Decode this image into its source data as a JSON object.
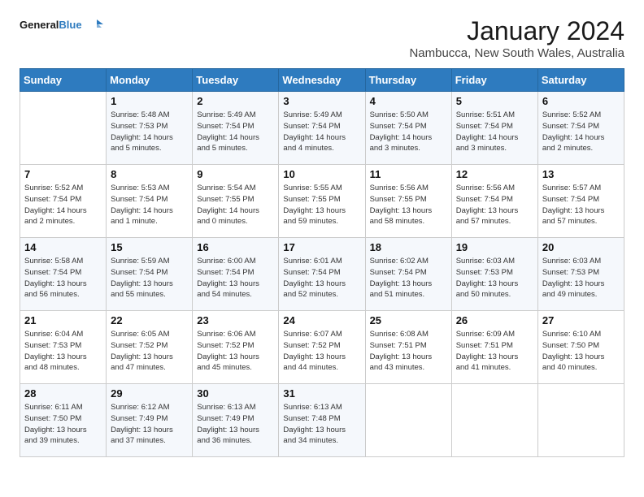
{
  "logo": {
    "line1": "General",
    "line2": "Blue"
  },
  "title": "January 2024",
  "location": "Nambucca, New South Wales, Australia",
  "days_of_week": [
    "Sunday",
    "Monday",
    "Tuesday",
    "Wednesday",
    "Thursday",
    "Friday",
    "Saturday"
  ],
  "weeks": [
    [
      {
        "num": "",
        "info": ""
      },
      {
        "num": "1",
        "info": "Sunrise: 5:48 AM\nSunset: 7:53 PM\nDaylight: 14 hours\nand 5 minutes."
      },
      {
        "num": "2",
        "info": "Sunrise: 5:49 AM\nSunset: 7:54 PM\nDaylight: 14 hours\nand 5 minutes."
      },
      {
        "num": "3",
        "info": "Sunrise: 5:49 AM\nSunset: 7:54 PM\nDaylight: 14 hours\nand 4 minutes."
      },
      {
        "num": "4",
        "info": "Sunrise: 5:50 AM\nSunset: 7:54 PM\nDaylight: 14 hours\nand 3 minutes."
      },
      {
        "num": "5",
        "info": "Sunrise: 5:51 AM\nSunset: 7:54 PM\nDaylight: 14 hours\nand 3 minutes."
      },
      {
        "num": "6",
        "info": "Sunrise: 5:52 AM\nSunset: 7:54 PM\nDaylight: 14 hours\nand 2 minutes."
      }
    ],
    [
      {
        "num": "7",
        "info": "Sunrise: 5:52 AM\nSunset: 7:54 PM\nDaylight: 14 hours\nand 2 minutes."
      },
      {
        "num": "8",
        "info": "Sunrise: 5:53 AM\nSunset: 7:54 PM\nDaylight: 14 hours\nand 1 minute."
      },
      {
        "num": "9",
        "info": "Sunrise: 5:54 AM\nSunset: 7:55 PM\nDaylight: 14 hours\nand 0 minutes."
      },
      {
        "num": "10",
        "info": "Sunrise: 5:55 AM\nSunset: 7:55 PM\nDaylight: 13 hours\nand 59 minutes."
      },
      {
        "num": "11",
        "info": "Sunrise: 5:56 AM\nSunset: 7:55 PM\nDaylight: 13 hours\nand 58 minutes."
      },
      {
        "num": "12",
        "info": "Sunrise: 5:56 AM\nSunset: 7:54 PM\nDaylight: 13 hours\nand 57 minutes."
      },
      {
        "num": "13",
        "info": "Sunrise: 5:57 AM\nSunset: 7:54 PM\nDaylight: 13 hours\nand 57 minutes."
      }
    ],
    [
      {
        "num": "14",
        "info": "Sunrise: 5:58 AM\nSunset: 7:54 PM\nDaylight: 13 hours\nand 56 minutes."
      },
      {
        "num": "15",
        "info": "Sunrise: 5:59 AM\nSunset: 7:54 PM\nDaylight: 13 hours\nand 55 minutes."
      },
      {
        "num": "16",
        "info": "Sunrise: 6:00 AM\nSunset: 7:54 PM\nDaylight: 13 hours\nand 54 minutes."
      },
      {
        "num": "17",
        "info": "Sunrise: 6:01 AM\nSunset: 7:54 PM\nDaylight: 13 hours\nand 52 minutes."
      },
      {
        "num": "18",
        "info": "Sunrise: 6:02 AM\nSunset: 7:54 PM\nDaylight: 13 hours\nand 51 minutes."
      },
      {
        "num": "19",
        "info": "Sunrise: 6:03 AM\nSunset: 7:53 PM\nDaylight: 13 hours\nand 50 minutes."
      },
      {
        "num": "20",
        "info": "Sunrise: 6:03 AM\nSunset: 7:53 PM\nDaylight: 13 hours\nand 49 minutes."
      }
    ],
    [
      {
        "num": "21",
        "info": "Sunrise: 6:04 AM\nSunset: 7:53 PM\nDaylight: 13 hours\nand 48 minutes."
      },
      {
        "num": "22",
        "info": "Sunrise: 6:05 AM\nSunset: 7:52 PM\nDaylight: 13 hours\nand 47 minutes."
      },
      {
        "num": "23",
        "info": "Sunrise: 6:06 AM\nSunset: 7:52 PM\nDaylight: 13 hours\nand 45 minutes."
      },
      {
        "num": "24",
        "info": "Sunrise: 6:07 AM\nSunset: 7:52 PM\nDaylight: 13 hours\nand 44 minutes."
      },
      {
        "num": "25",
        "info": "Sunrise: 6:08 AM\nSunset: 7:51 PM\nDaylight: 13 hours\nand 43 minutes."
      },
      {
        "num": "26",
        "info": "Sunrise: 6:09 AM\nSunset: 7:51 PM\nDaylight: 13 hours\nand 41 minutes."
      },
      {
        "num": "27",
        "info": "Sunrise: 6:10 AM\nSunset: 7:50 PM\nDaylight: 13 hours\nand 40 minutes."
      }
    ],
    [
      {
        "num": "28",
        "info": "Sunrise: 6:11 AM\nSunset: 7:50 PM\nDaylight: 13 hours\nand 39 minutes."
      },
      {
        "num": "29",
        "info": "Sunrise: 6:12 AM\nSunset: 7:49 PM\nDaylight: 13 hours\nand 37 minutes."
      },
      {
        "num": "30",
        "info": "Sunrise: 6:13 AM\nSunset: 7:49 PM\nDaylight: 13 hours\nand 36 minutes."
      },
      {
        "num": "31",
        "info": "Sunrise: 6:13 AM\nSunset: 7:48 PM\nDaylight: 13 hours\nand 34 minutes."
      },
      {
        "num": "",
        "info": ""
      },
      {
        "num": "",
        "info": ""
      },
      {
        "num": "",
        "info": ""
      }
    ]
  ]
}
